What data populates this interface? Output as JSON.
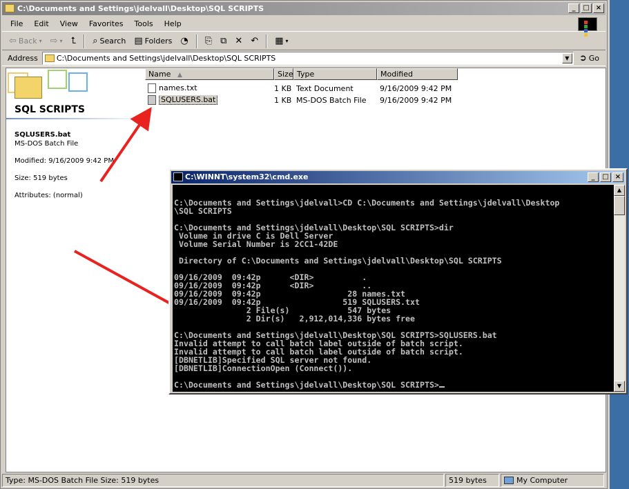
{
  "explorer": {
    "title": "C:\\Documents and Settings\\jdelvall\\Desktop\\SQL SCRIPTS",
    "menu": [
      "File",
      "Edit",
      "View",
      "Favorites",
      "Tools",
      "Help"
    ],
    "toolbar": {
      "back": "Back",
      "search": "Search",
      "folders": "Folders"
    },
    "address": {
      "label": "Address",
      "value": "C:\\Documents and Settings\\jdelvall\\Desktop\\SQL SCRIPTS",
      "go": "Go"
    },
    "leftpane": {
      "folder_title": "SQL SCRIPTS",
      "selected_name": "SQLUSERS.bat",
      "selected_type": "MS-DOS Batch File",
      "modified": "Modified: 9/16/2009 9:42 PM",
      "size": "Size: 519 bytes",
      "attributes": "Attributes: (normal)"
    },
    "columns": [
      "Name",
      "Size",
      "Type",
      "Modified"
    ],
    "files": [
      {
        "name": "names.txt",
        "size": "1 KB",
        "type": "Text Document",
        "modified": "9/16/2009 9:42 PM"
      },
      {
        "name": "SQLUSERS.bat",
        "size": "1 KB",
        "type": "MS-DOS Batch File",
        "modified": "9/16/2009 9:42 PM"
      }
    ],
    "status": {
      "left": "Type: MS-DOS Batch File Size: 519 bytes",
      "size": "519 bytes",
      "zone": "My Computer"
    }
  },
  "cmd": {
    "title": "C:\\WINNT\\system32\\cmd.exe",
    "lines": [
      "",
      "C:\\Documents and Settings\\jdelvall>CD C:\\Documents and Settings\\jdelvall\\Desktop",
      "\\SQL SCRIPTS",
      "",
      "C:\\Documents and Settings\\jdelvall\\Desktop\\SQL SCRIPTS>dir",
      " Volume in drive C is Dell Server",
      " Volume Serial Number is 2CC1-42DE",
      "",
      " Directory of C:\\Documents and Settings\\jdelvall\\Desktop\\SQL SCRIPTS",
      "",
      "09/16/2009  09:42p      <DIR>          .",
      "09/16/2009  09:42p      <DIR>          ..",
      "09/16/2009  09:42p                  28 names.txt",
      "09/16/2009  09:42p                 519 SQLUSERS.txt",
      "               2 File(s)            547 bytes",
      "               2 Dir(s)   2,912,014,336 bytes free",
      "",
      "C:\\Documents and Settings\\jdelvall\\Desktop\\SQL SCRIPTS>SQLUSERS.bat",
      "Invalid attempt to call batch label outside of batch script.",
      "Invalid attempt to call batch label outside of batch script.",
      "[DBNETLIB]Specified SQL server not found.",
      "[DBNETLIB]ConnectionOpen (Connect()).",
      "",
      "C:\\Documents and Settings\\jdelvall\\Desktop\\SQL SCRIPTS>"
    ]
  },
  "colors": {
    "arrow": "#e8221e",
    "cmd_title": "#0a246a",
    "inactive_title": "#808080",
    "desktop": "#3a6ea5"
  }
}
